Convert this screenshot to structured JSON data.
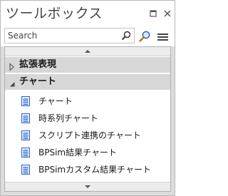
{
  "window": {
    "title": "ツールボックス",
    "float_icon": "float-window-icon",
    "close_icon": "close-icon"
  },
  "search": {
    "placeholder": "Search",
    "value": "",
    "search_icon": "search-icon",
    "find_icon": "find-icon",
    "menu_icon": "hamburger-menu-icon"
  },
  "groups": [
    {
      "label": "拡張表現",
      "expanded": false
    },
    {
      "label": "チャート",
      "expanded": true
    }
  ],
  "items": [
    {
      "label": "チャート",
      "icon": "chart-doc-icon"
    },
    {
      "label": "時系列チャート",
      "icon": "chart-doc-icon"
    },
    {
      "label": "スクリプト連携のチャート",
      "icon": "chart-doc-icon"
    },
    {
      "label": "BPSim結果チャート",
      "icon": "chart-doc-icon"
    },
    {
      "label": "BPSimカスタム結果チャート",
      "icon": "chart-doc-icon"
    }
  ],
  "colors": {
    "panel_background": "#dcdcdc",
    "group_header": "#d7d7d7",
    "icon_blue": "#2b63c6"
  }
}
